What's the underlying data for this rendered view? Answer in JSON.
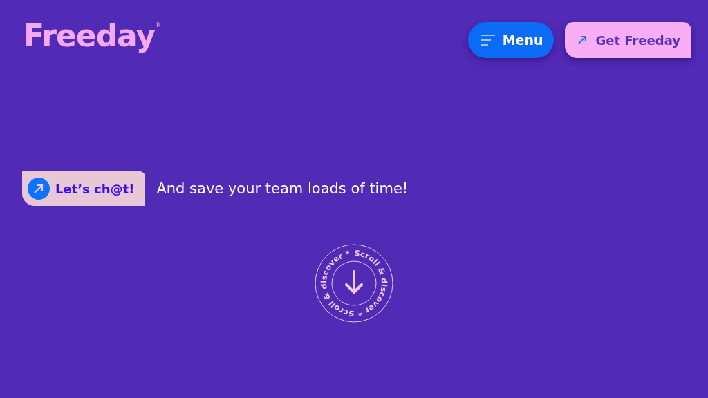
{
  "header": {
    "logo": "Freeday$^{®}$",
    "menu_button": {
      "label": "Menu"
    },
    "cta_button": {
      "label": "Get Freeday"
    }
  },
  "hero": {
    "chat_button": {
      "label": "Let’s ch@t!"
    },
    "tagline": "And save your team loads of time!"
  },
  "scroll_badge": {
    "circle_text": "Scroll & discover * Scroll & discover *"
  }
}
